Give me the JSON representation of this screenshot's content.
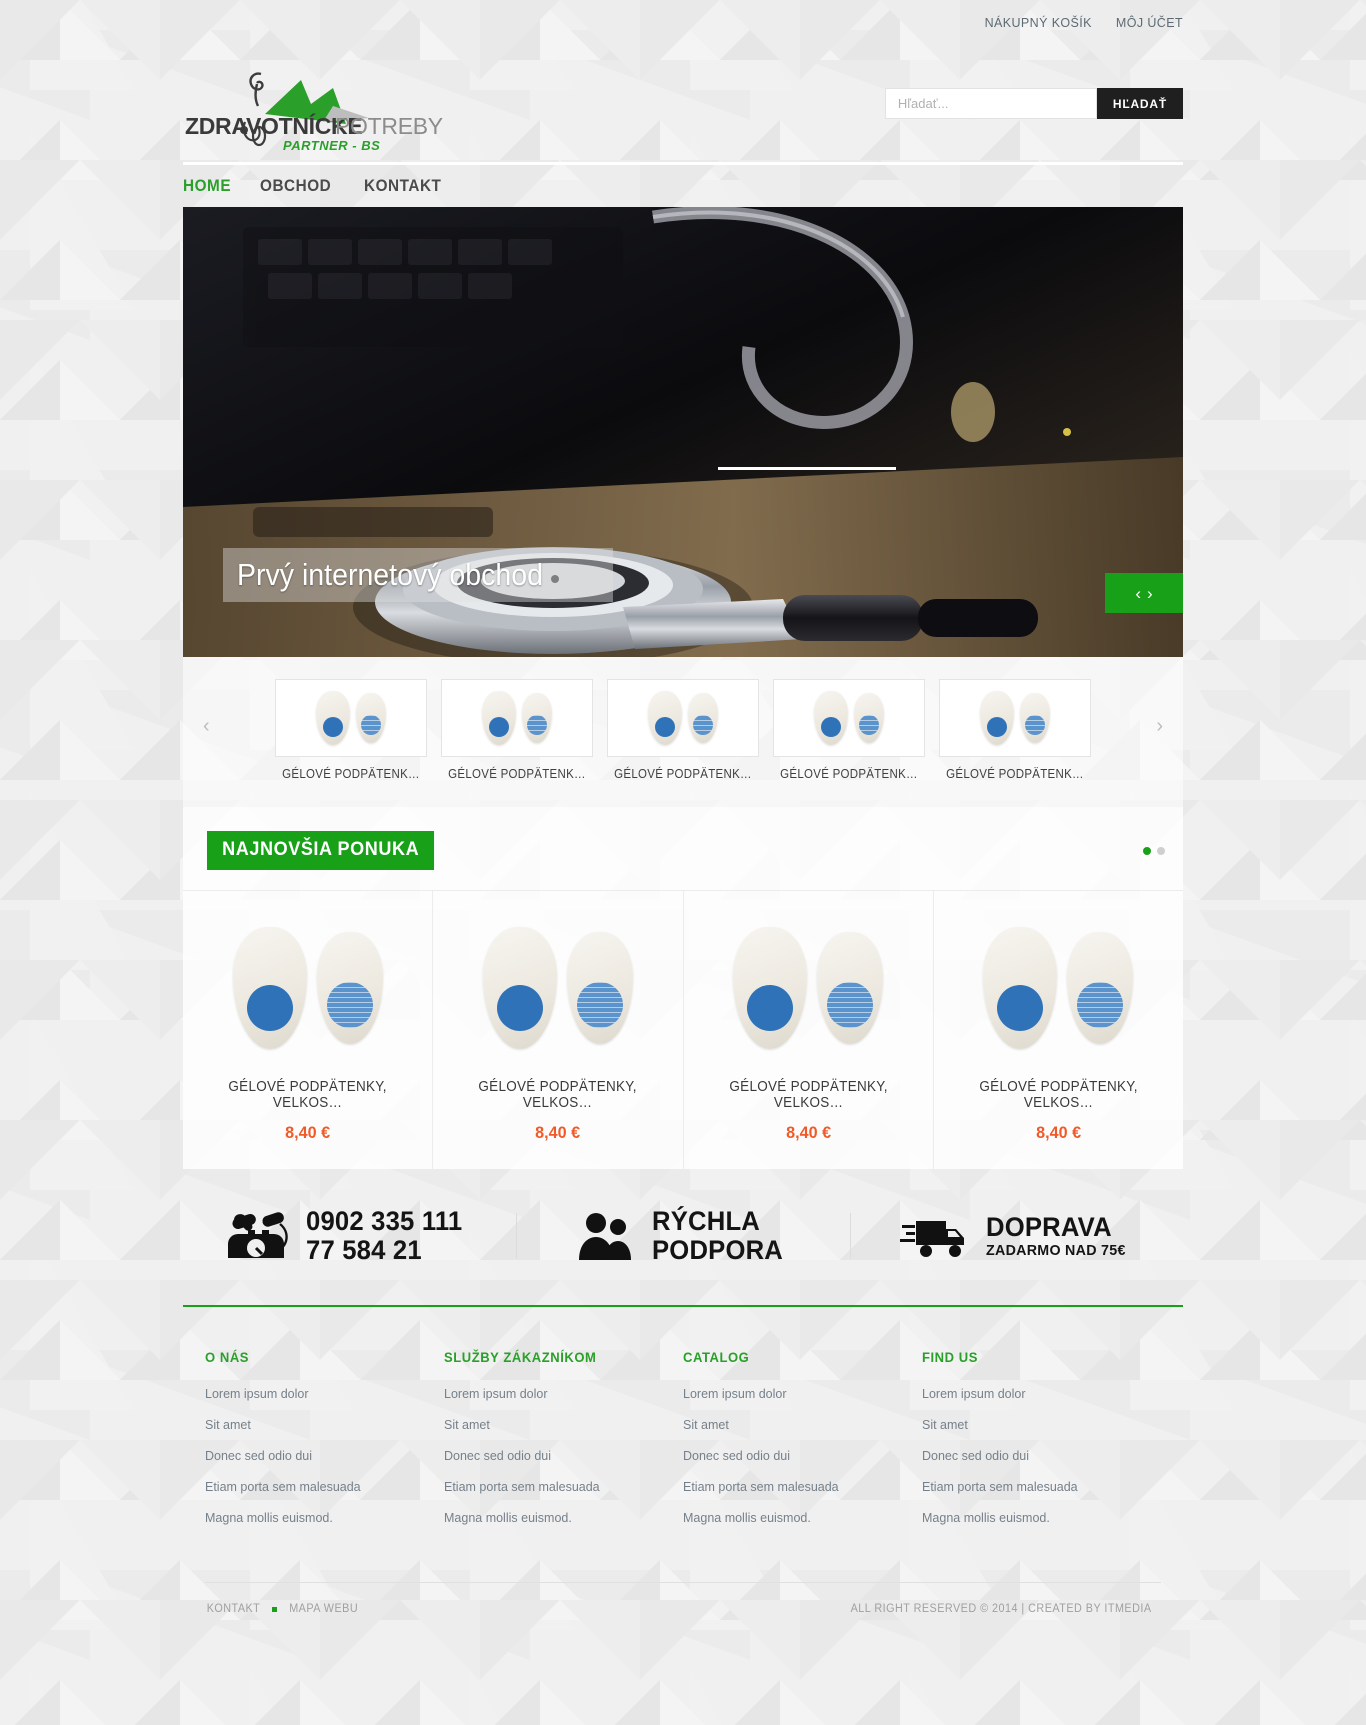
{
  "topbar": {
    "links": [
      {
        "label": "NÁKUPNÝ KOŠÍK",
        "name": "cart-link"
      },
      {
        "label": "MÔJ ÚČET",
        "name": "account-link"
      }
    ]
  },
  "logo": {
    "line1_bold": "ZDRAVOTNÍCKE",
    "line1_light": "POTREBY",
    "line2": "PARTNER - BS",
    "green": "#2aa02a"
  },
  "search": {
    "placeholder": "Hľadať...",
    "value": "",
    "button_label": "HĽADAŤ"
  },
  "nav": {
    "items": [
      {
        "label": "HOME",
        "active": true
      },
      {
        "label": "OBCHOD",
        "active": false
      },
      {
        "label": "KONTAKT",
        "active": false
      }
    ]
  },
  "hero": {
    "caption": "Prvý internetový obchod",
    "prev_glyph": "‹",
    "next_glyph": "›"
  },
  "thumb_carousel": {
    "prev_glyph": "‹",
    "next_glyph": "›",
    "items": [
      {
        "label": "GÉLOVÉ PODPÄTENK…"
      },
      {
        "label": "GÉLOVÉ PODPÄTENK…"
      },
      {
        "label": "GÉLOVÉ PODPÄTENK…"
      },
      {
        "label": "GÉLOVÉ PODPÄTENK…"
      },
      {
        "label": "GÉLOVÉ PODPÄTENK…"
      }
    ]
  },
  "offer": {
    "badge": "NAJNOVŠIA PONUKA",
    "accent": "#18a018",
    "price_color": "#f05a28",
    "pager": [
      {
        "on": true
      },
      {
        "on": false
      }
    ],
    "products": [
      {
        "name": "GÉLOVÉ PODPÄTENKY, VELKOS…",
        "price": "8,40 €"
      },
      {
        "name": "GÉLOVÉ PODPÄTENKY, VELKOS…",
        "price": "8,40 €"
      },
      {
        "name": "GÉLOVÉ PODPÄTENKY, VELKOS…",
        "price": "8,40 €"
      },
      {
        "name": "GÉLOVÉ PODPÄTENKY, VELKOS…",
        "price": "8,40 €"
      }
    ]
  },
  "services": [
    {
      "icon": "phone-icon",
      "big": "0902 335 111",
      "small": "77 584 21"
    },
    {
      "icon": "support-people-icon",
      "big": "RÝCHLA",
      "small": "PODPORA"
    },
    {
      "icon": "delivery-truck-icon",
      "big": "DOPRAVA",
      "small": "ZADARMO NAD 75€"
    }
  ],
  "footer": {
    "columns": [
      {
        "title": "O NÁS",
        "links": [
          "Lorem ipsum dolor",
          "Sit amet",
          "Donec sed odio dui",
          "Etiam porta sem malesuada",
          "Magna mollis euismod."
        ]
      },
      {
        "title": "SLUŽBY ZÁKAZNÍKOM",
        "links": [
          "Lorem ipsum dolor",
          "Sit amet",
          "Donec sed odio dui",
          "Etiam porta sem malesuada",
          "Magna mollis euismod."
        ]
      },
      {
        "title": "CATALOG",
        "links": [
          "Lorem ipsum dolor",
          "Sit amet",
          "Donec sed odio dui",
          "Etiam porta sem malesuada",
          "Magna mollis euismod."
        ]
      },
      {
        "title": "FIND US",
        "links": [
          "Lorem ipsum dolor",
          "Sit amet",
          "Donec sed odio dui",
          "Etiam porta sem malesuada",
          "Magna mollis euismod."
        ]
      }
    ],
    "bottom": {
      "kontakt": "KONTAKT",
      "mapa": "MAPA WEBU",
      "copyright": "ALL RIGHT RESERVED © 2014 | CREATED BY ITMEDIA"
    }
  }
}
